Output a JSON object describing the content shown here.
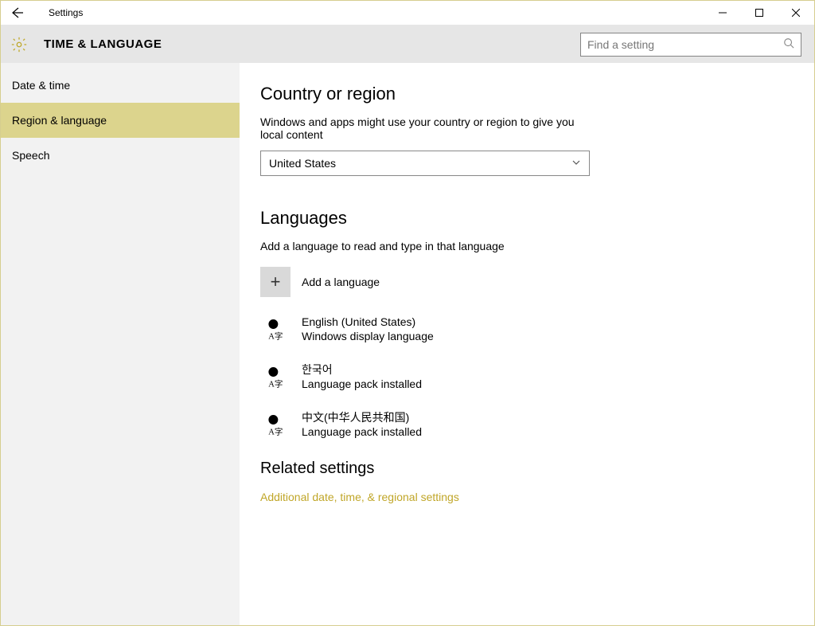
{
  "titlebar": {
    "app_title": "Settings"
  },
  "header": {
    "title": "TIME & LANGUAGE",
    "search_placeholder": "Find a setting"
  },
  "sidebar": {
    "items": [
      {
        "label": "Date & time",
        "active": false
      },
      {
        "label": "Region & language",
        "active": true
      },
      {
        "label": "Speech",
        "active": false
      }
    ]
  },
  "content": {
    "country": {
      "title": "Country or region",
      "desc": "Windows and apps might use your country or region to give you local content",
      "selected": "United States"
    },
    "languages": {
      "title": "Languages",
      "desc": "Add a language to read and type in that language",
      "add_label": "Add a language",
      "list": [
        {
          "name": "English (United States)",
          "sub": "Windows display language"
        },
        {
          "name": "한국어",
          "sub": "Language pack installed"
        },
        {
          "name": "中文(中华人民共和国)",
          "sub": "Language pack installed"
        }
      ]
    },
    "related": {
      "title": "Related settings",
      "link": "Additional date, time, & regional settings"
    }
  }
}
